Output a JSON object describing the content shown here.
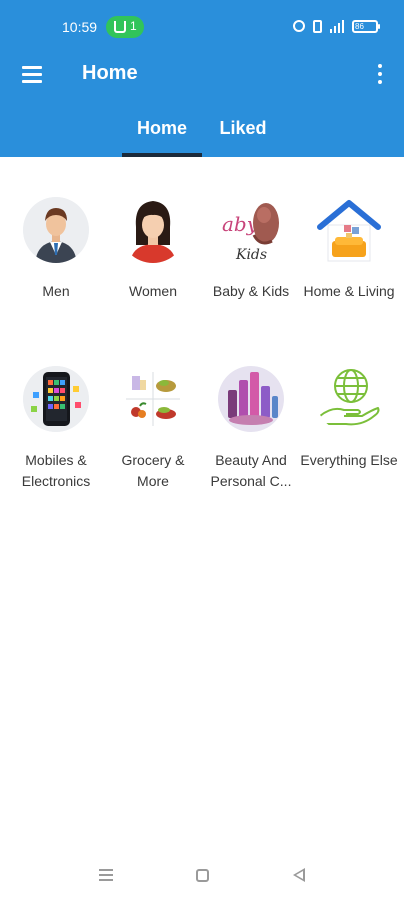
{
  "status_bar": {
    "time": "10:59",
    "network_count": "1",
    "battery": "86"
  },
  "header": {
    "title": "Home"
  },
  "tabs": [
    {
      "label": "Home",
      "selected": true
    },
    {
      "label": "Liked",
      "selected": false
    }
  ],
  "categories": [
    {
      "label": "Men",
      "icon": "businessman-icon"
    },
    {
      "label": "Women",
      "icon": "woman-icon"
    },
    {
      "label": "Baby & Kids",
      "icon": "baby-kids-icon"
    },
    {
      "label": "Home & Living",
      "icon": "house-icon"
    },
    {
      "label": "Mobiles & Electronics",
      "icon": "smartphone-apps-icon"
    },
    {
      "label": "Grocery & More",
      "icon": "groceries-icon"
    },
    {
      "label": "Beauty And Personal C...",
      "icon": "cosmetics-icon"
    },
    {
      "label": "Everything Else",
      "icon": "globe-hand-icon"
    }
  ],
  "colors": {
    "app_bar": "#2a8fdb",
    "tab_indicator": "#1b2a3a",
    "status_pill": "#31c45a"
  }
}
